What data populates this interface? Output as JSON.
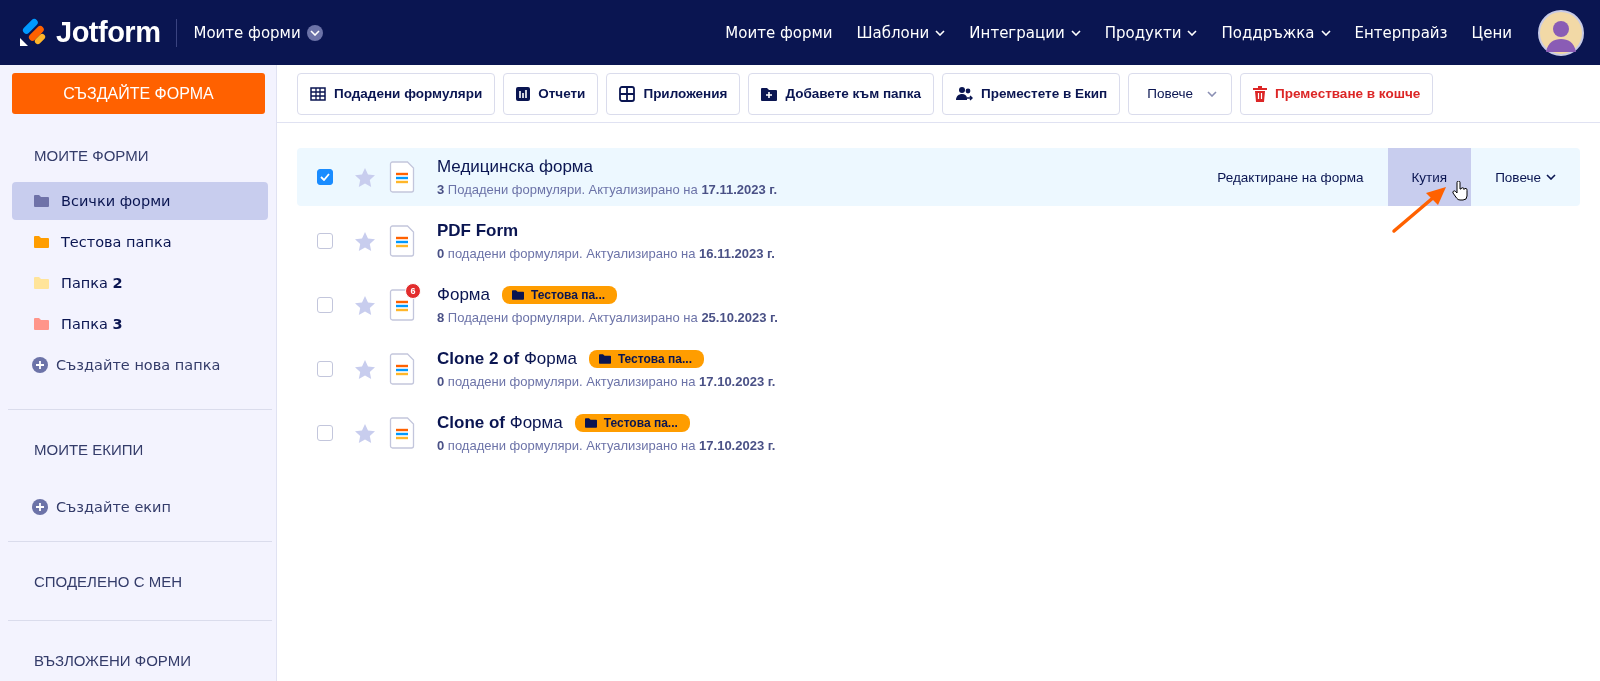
{
  "header": {
    "logo": "Jotform",
    "workspace": "Моите форми",
    "nav": [
      {
        "label": "Моите форми",
        "dropdown": false
      },
      {
        "label": "Шаблони",
        "dropdown": true
      },
      {
        "label": "Интеграции",
        "dropdown": true
      },
      {
        "label": "Продукти",
        "dropdown": true
      },
      {
        "label": "Поддръжка",
        "dropdown": true
      },
      {
        "label": "Ентерпрайз",
        "dropdown": false
      },
      {
        "label": "Цени",
        "dropdown": false
      }
    ]
  },
  "sidebar": {
    "create_button": "СЪЗДАЙТЕ ФОРМА",
    "sections": [
      {
        "heading": "МОИТЕ ФОРМИ",
        "items": [
          {
            "kind": "folder",
            "label": "Всички форми",
            "selected": true,
            "color": "#6f72a8"
          },
          {
            "kind": "folder",
            "label": "Тестова папка",
            "selected": false,
            "color": "#ff9d00"
          },
          {
            "kind": "folder",
            "label": "Папка **2**",
            "selected": false,
            "color": "#ffe49a"
          },
          {
            "kind": "folder",
            "label": "Папка **3**",
            "selected": false,
            "color": "#ff958a"
          },
          {
            "kind": "add",
            "label": "Създайте нова папка",
            "selected": false
          }
        ]
      },
      {
        "heading": "МОИТЕ ЕКИПИ",
        "items": [
          {
            "kind": "add",
            "label": "Създайте екип",
            "selected": false
          }
        ]
      },
      {
        "heading": "СПОДЕЛЕНО С МЕН"
      },
      {
        "heading": "ВЪЗЛОЖЕНИ ФОРМИ"
      }
    ]
  },
  "toolbar": [
    {
      "kind": "table",
      "label": "Подадени формуляри"
    },
    {
      "kind": "report",
      "label": "Отчети"
    },
    {
      "kind": "apps",
      "label": "Приложения"
    },
    {
      "kind": "folder",
      "label": "Добавете към папка"
    },
    {
      "kind": "team",
      "label": "Преместете в Екип"
    },
    {
      "kind": "more",
      "label": "Повече"
    },
    {
      "kind": "trash",
      "label": "Преместване в кошче"
    }
  ],
  "forms": [
    {
      "title": "Медицинска форма",
      "subtitle": "**3** Подадени формуляри. Актуализирано на **17.11.2023 г.**",
      "checked": true,
      "selected": true,
      "starred": false,
      "actions": [
        {
          "label": "Редактиране на форма",
          "hovered": false,
          "dropdown": false
        },
        {
          "label": "Кутия",
          "hovered": true,
          "dropdown": false
        },
        {
          "label": "Повече",
          "hovered": false,
          "dropdown": true
        }
      ]
    },
    {
      "title": "**PDF Form**",
      "subtitle": "**0** подадени формуляри. Актуализирано на **16.11.2023 г.**",
      "checked": false,
      "selected": false,
      "starred": false
    },
    {
      "title": "Форма",
      "subtitle": "**8** Подадени формуляри. Актуализирано на **25.10.2023 г.**",
      "checked": false,
      "selected": false,
      "starred": false,
      "badge": "6",
      "folder_tag": "Тестова па..."
    },
    {
      "title": "**Clone 2 of** Форма",
      "subtitle": "**0** подадени формуляри. Актуализирано на **17.10.2023 г.**",
      "checked": false,
      "selected": false,
      "starred": false,
      "folder_tag": "Тестова па..."
    },
    {
      "title": "**Clone of** Форма",
      "subtitle": "**0** подадени формуляри. Актуализирано на **17.10.2023 г.**",
      "checked": false,
      "selected": false,
      "starred": false,
      "folder_tag": "Тестова па..."
    }
  ]
}
